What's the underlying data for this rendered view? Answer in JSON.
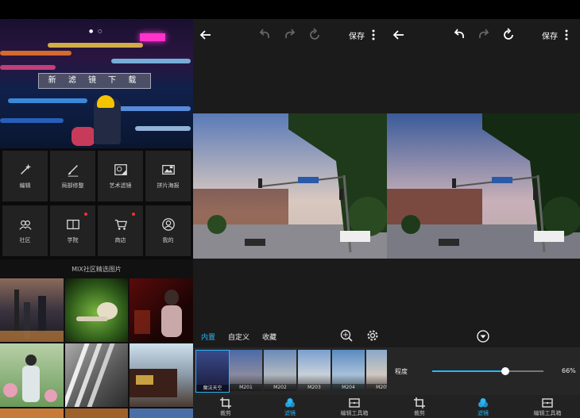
{
  "left_panel": {
    "banner": {
      "title": "新 滤 镜 下 载"
    },
    "tools": [
      {
        "label": "编辑",
        "icon": "magic-wand-icon",
        "badge": false
      },
      {
        "label": "局部修整",
        "icon": "brush-icon",
        "badge": false
      },
      {
        "label": "艺术滤镜",
        "icon": "art-filter-icon",
        "badge": false
      },
      {
        "label": "拼片海报",
        "icon": "poster-icon",
        "badge": false
      },
      {
        "label": "社区",
        "icon": "community-icon",
        "badge": false
      },
      {
        "label": "学院",
        "icon": "book-icon",
        "badge": true
      },
      {
        "label": "商店",
        "icon": "cart-icon",
        "badge": true
      },
      {
        "label": "我的",
        "icon": "profile-icon",
        "badge": false
      }
    ],
    "gallery_label": "MIX社区精选图片"
  },
  "middle_panel": {
    "save": "保存",
    "tabs": [
      "内置",
      "自定义",
      "收藏"
    ],
    "filters": [
      "魔法天空",
      "M201",
      "M202",
      "M203",
      "M204",
      "M205"
    ],
    "nav": [
      {
        "label": "裁剪",
        "icon": "crop-icon"
      },
      {
        "label": "滤镜",
        "icon": "filter-icon"
      },
      {
        "label": "编辑工具箱",
        "icon": "toolbox-icon"
      }
    ]
  },
  "right_panel": {
    "save": "保存",
    "slider": {
      "label": "程度",
      "value": "66%",
      "fraction": 0.66
    },
    "nav": [
      {
        "label": "裁剪",
        "icon": "crop-icon"
      },
      {
        "label": "滤镜",
        "icon": "filter-icon"
      },
      {
        "label": "编辑工具箱",
        "icon": "toolbox-icon"
      }
    ]
  },
  "colors": {
    "accent": "#29b6f6",
    "background": "#1b1b1b",
    "badge": "#e33333"
  }
}
